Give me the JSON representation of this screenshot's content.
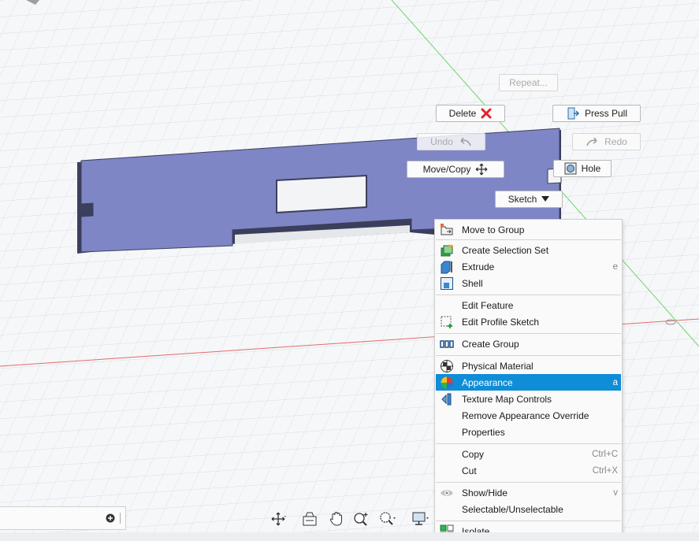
{
  "marking_menu": {
    "repeat": "Repeat...",
    "delete": "Delete",
    "press_pull": "Press Pull",
    "undo": "Undo",
    "redo": "Redo",
    "move_copy": "Move/Copy",
    "hole": "Hole",
    "sketch": "Sketch"
  },
  "context_menu": {
    "items": [
      {
        "label": "Move to Group",
        "shortcut": "",
        "icon": "move-to-group-icon"
      },
      {
        "label": "Create Selection Set",
        "shortcut": "",
        "icon": "selection-set-icon"
      },
      {
        "label": "Extrude",
        "shortcut": "e",
        "icon": "extrude-icon"
      },
      {
        "label": "Shell",
        "shortcut": "",
        "icon": "shell-icon"
      },
      {
        "label": "Edit Feature",
        "shortcut": "",
        "icon": ""
      },
      {
        "label": "Edit Profile Sketch",
        "shortcut": "",
        "icon": "edit-profile-sketch-icon"
      },
      {
        "label": "Create Group",
        "shortcut": "",
        "icon": "group-icon"
      },
      {
        "label": "Physical Material",
        "shortcut": "",
        "icon": "physical-material-icon"
      },
      {
        "label": "Appearance",
        "shortcut": "a",
        "icon": "appearance-icon",
        "highlighted": true
      },
      {
        "label": "Texture Map Controls",
        "shortcut": "",
        "icon": "texture-map-icon"
      },
      {
        "label": "Remove Appearance Override",
        "shortcut": "",
        "icon": ""
      },
      {
        "label": "Properties",
        "shortcut": "",
        "icon": ""
      },
      {
        "label": "Copy",
        "shortcut": "Ctrl+C",
        "icon": ""
      },
      {
        "label": "Cut",
        "shortcut": "Ctrl+X",
        "icon": ""
      },
      {
        "label": "Show/Hide",
        "shortcut": "v",
        "icon": "eye-icon"
      },
      {
        "label": "Selectable/Unselectable",
        "shortcut": "",
        "icon": ""
      },
      {
        "label": "Isolate",
        "shortcut": "",
        "icon": "isolate-icon"
      }
    ]
  },
  "colors": {
    "body_face": "#7f86c6",
    "body_edge": "#3b3f5c",
    "highlight": "#0f8dd6",
    "grid_line": "#d9dce2",
    "axis_red": "#e26b6b",
    "axis_green": "#5fd15f",
    "delete_red": "#e0242c",
    "canvas_bg": "#f6f7f9"
  },
  "navigation_bar": {
    "tools": [
      "orbit-icon",
      "look-at-icon",
      "pan-icon",
      "zoom-icon",
      "zoom-window-icon",
      "display-settings-icon"
    ]
  }
}
